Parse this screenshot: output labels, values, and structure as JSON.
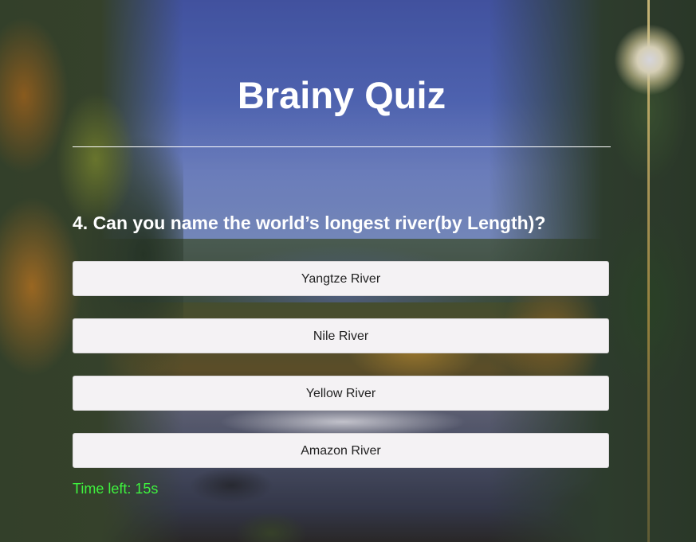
{
  "app": {
    "title": "Brainy Quiz"
  },
  "question": {
    "number": "4.",
    "text": "4. Can you name the world’s longest river(by Length)?"
  },
  "answers": [
    {
      "label": "Yangtze River"
    },
    {
      "label": "Nile River"
    },
    {
      "label": "Yellow River"
    },
    {
      "label": "Amazon River"
    }
  ],
  "timer": {
    "text": "Time left: 15s",
    "color": "#3ef23e"
  },
  "colors": {
    "title": "#ffffff",
    "button_bg": "#f4f2f4",
    "button_text": "#222222"
  }
}
